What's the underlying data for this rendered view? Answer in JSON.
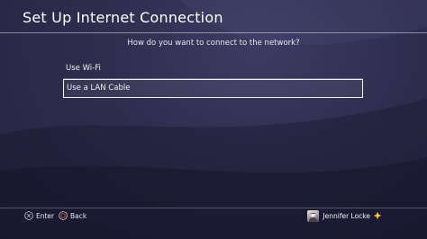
{
  "header": {
    "title": "Set Up Internet Connection"
  },
  "prompt": "How do you want to connect to the network?",
  "options": [
    {
      "label": "Use Wi-Fi",
      "selected": false
    },
    {
      "label": "Use a LAN Cable",
      "selected": true
    }
  ],
  "footer": {
    "enter": {
      "icon": "cross-icon",
      "label": "Enter"
    },
    "back": {
      "icon": "circle-icon",
      "label": "Back"
    }
  },
  "user": {
    "name": "Jennifer Locke",
    "badge_icon": "playstation-plus-icon"
  },
  "colors": {
    "background": "#2e2d4e",
    "text": "#ffffff",
    "circle_button": "#d64a4a",
    "plus_badge": "#f5c518"
  }
}
